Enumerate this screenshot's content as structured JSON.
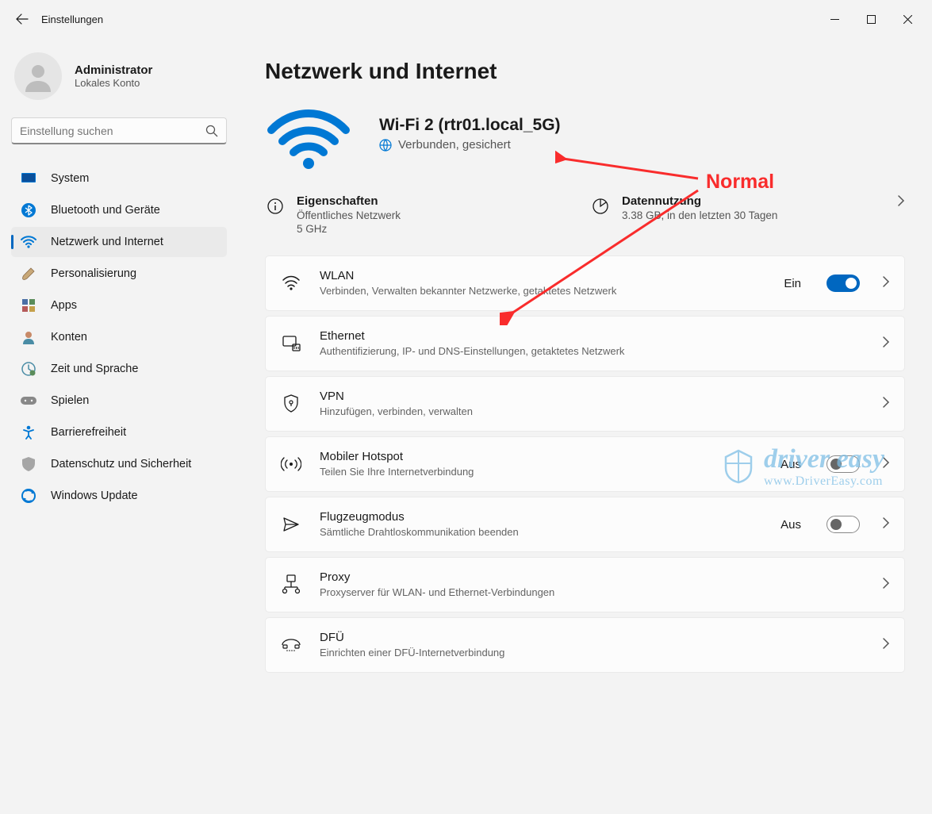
{
  "window": {
    "title": "Einstellungen"
  },
  "user": {
    "name": "Administrator",
    "sub": "Lokales Konto"
  },
  "search": {
    "placeholder": "Einstellung suchen"
  },
  "nav": [
    {
      "label": "System"
    },
    {
      "label": "Bluetooth und Geräte"
    },
    {
      "label": "Netzwerk und Internet"
    },
    {
      "label": "Personalisierung"
    },
    {
      "label": "Apps"
    },
    {
      "label": "Konten"
    },
    {
      "label": "Zeit und Sprache"
    },
    {
      "label": "Spielen"
    },
    {
      "label": "Barrierefreiheit"
    },
    {
      "label": "Datenschutz und Sicherheit"
    },
    {
      "label": "Windows Update"
    }
  ],
  "page": {
    "title": "Netzwerk und Internet"
  },
  "connection": {
    "name": "Wi-Fi 2 (rtr01.local_5G)",
    "status": "Verbunden, gesichert"
  },
  "info": {
    "properties": {
      "title": "Eigenschaften",
      "line1": "Öffentliches Netzwerk",
      "line2": "5 GHz"
    },
    "usage": {
      "title": "Datennutzung",
      "line1": "3.38 GB, in den letzten 30 Tagen"
    }
  },
  "cards": {
    "wlan": {
      "title": "WLAN",
      "sub": "Verbinden, Verwalten bekannter Netzwerke, getaktetes Netzwerk",
      "state": "Ein"
    },
    "ethernet": {
      "title": "Ethernet",
      "sub": "Authentifizierung, IP- und DNS-Einstellungen, getaktetes Netzwerk"
    },
    "vpn": {
      "title": "VPN",
      "sub": "Hinzufügen, verbinden, verwalten"
    },
    "hotspot": {
      "title": "Mobiler Hotspot",
      "sub": "Teilen Sie Ihre Internetverbindung",
      "state": "Aus"
    },
    "airplane": {
      "title": "Flugzeugmodus",
      "sub": "Sämtliche Drahtloskommunikation beenden",
      "state": "Aus"
    },
    "proxy": {
      "title": "Proxy",
      "sub": "Proxyserver für WLAN- und Ethernet-Verbindungen"
    },
    "dfu": {
      "title": "DFÜ",
      "sub": "Einrichten einer DFÜ-Internetverbindung"
    }
  },
  "annotation": {
    "label": "Normal"
  },
  "watermark": {
    "line1": "driver easy",
    "line2": "www.DriverEasy.com"
  }
}
